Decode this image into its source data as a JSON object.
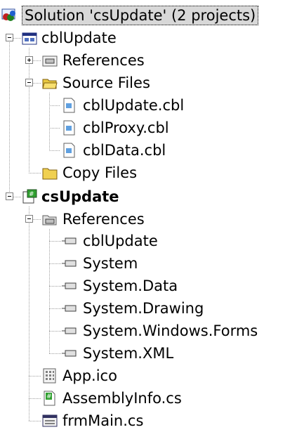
{
  "tree": {
    "solution": {
      "label": "Solution 'csUpdate' (2 projects)",
      "icon": "solution-icon"
    },
    "cbl_project": {
      "label": "cblUpdate",
      "icon": "cobol-project-icon",
      "references": {
        "label": "References",
        "icon": "references-folder-icon"
      },
      "source_files": {
        "label": "Source Files",
        "icon": "open-folder-icon",
        "files": [
          {
            "label": "cblUpdate.cbl",
            "icon": "cbl-file-icon"
          },
          {
            "label": "cblProxy.cbl",
            "icon": "cbl-file-icon"
          },
          {
            "label": "cblData.cbl",
            "icon": "cbl-file-icon"
          }
        ]
      },
      "copy_files": {
        "label": "Copy Files",
        "icon": "closed-folder-icon"
      }
    },
    "cs_project": {
      "label": "csUpdate",
      "icon": "csharp-project-icon",
      "references": {
        "label": "References",
        "icon": "references-folder-icon",
        "items": [
          {
            "label": "cblUpdate",
            "icon": "reference-icon"
          },
          {
            "label": "System",
            "icon": "reference-icon"
          },
          {
            "label": "System.Data",
            "icon": "reference-icon"
          },
          {
            "label": "System.Drawing",
            "icon": "reference-icon"
          },
          {
            "label": "System.Windows.Forms",
            "icon": "reference-icon"
          },
          {
            "label": "System.XML",
            "icon": "reference-icon"
          }
        ]
      },
      "files": [
        {
          "label": "App.ico",
          "icon": "ico-file-icon"
        },
        {
          "label": "AssemblyInfo.cs",
          "icon": "cs-file-icon"
        },
        {
          "label": "frmMain.cs",
          "icon": "form-file-icon"
        }
      ]
    }
  }
}
